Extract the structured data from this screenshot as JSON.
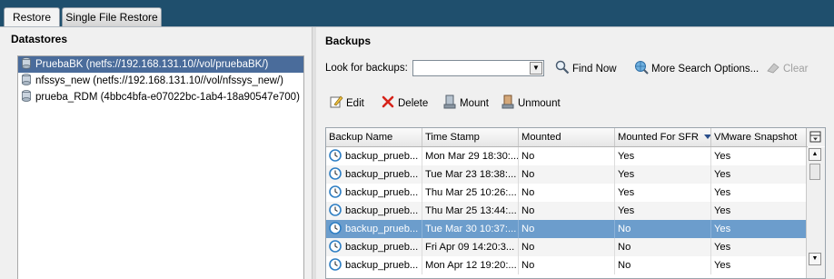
{
  "tabs": [
    {
      "label": "Restore",
      "active": true
    },
    {
      "label": "Single File Restore",
      "active": false
    }
  ],
  "datastores": {
    "title": "Datastores",
    "items": [
      {
        "label": "PruebaBK (netfs://192.168.131.10//vol/pruebaBK/)",
        "selected": true
      },
      {
        "label": "nfssys_new (netfs://192.168.131.10//vol/nfssys_new/)",
        "selected": false
      },
      {
        "label": "prueba_RDM (4bbc4bfa-e07022bc-1ab4-18a90547e700)",
        "selected": false
      }
    ]
  },
  "backups": {
    "title": "Backups",
    "look_label": "Look for backups:",
    "look_value": "",
    "find_now": "Find Now",
    "more_search": "More Search Options...",
    "clear": "Clear",
    "actions": {
      "edit": "Edit",
      "delete": "Delete",
      "mount": "Mount",
      "unmount": "Unmount"
    },
    "columns": [
      "Backup Name",
      "Time Stamp",
      "Mounted",
      "Mounted For SFR",
      "VMware Snapshot"
    ],
    "sorted_column": "Mounted For SFR",
    "rows": [
      {
        "name": "backup_prueb...",
        "time": "Mon Mar 29 18:30:...",
        "mounted": "No",
        "sfr": "Yes",
        "snapshot": "Yes",
        "selected": false
      },
      {
        "name": "backup_prueb...",
        "time": "Tue Mar 23 18:38:...",
        "mounted": "No",
        "sfr": "Yes",
        "snapshot": "Yes",
        "selected": false
      },
      {
        "name": "backup_prueb...",
        "time": "Thu Mar 25 10:26:...",
        "mounted": "No",
        "sfr": "Yes",
        "snapshot": "Yes",
        "selected": false
      },
      {
        "name": "backup_prueb...",
        "time": "Thu Mar 25 13:44:...",
        "mounted": "No",
        "sfr": "Yes",
        "snapshot": "Yes",
        "selected": false
      },
      {
        "name": "backup_prueb...",
        "time": "Tue Mar 30 10:37:...",
        "mounted": "No",
        "sfr": "No",
        "snapshot": "Yes",
        "selected": true
      },
      {
        "name": "backup_prueb...",
        "time": "Fri Apr 09 14:20:3...",
        "mounted": "No",
        "sfr": "No",
        "snapshot": "Yes",
        "selected": false
      },
      {
        "name": "backup_prueb...",
        "time": "Mon Apr 12 19:20:...",
        "mounted": "No",
        "sfr": "No",
        "snapshot": "Yes",
        "selected": false
      }
    ]
  },
  "colors": {
    "header_bar": "#1f4f6d",
    "selection": "#6c9dcc",
    "tree_selection": "#4a6c9b"
  }
}
